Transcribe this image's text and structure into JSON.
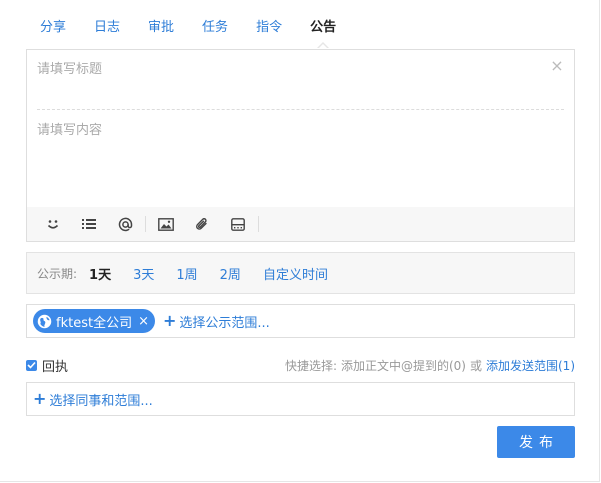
{
  "tabs": [
    {
      "label": "分享",
      "active": false
    },
    {
      "label": "日志",
      "active": false
    },
    {
      "label": "审批",
      "active": false
    },
    {
      "label": "任务",
      "active": false
    },
    {
      "label": "指令",
      "active": false
    },
    {
      "label": "公告",
      "active": true
    }
  ],
  "editor": {
    "title_placeholder": "请填写标题",
    "title_value": "",
    "content_placeholder": "请填写内容",
    "content_value": "",
    "clear_symbol": "×",
    "toolbar_icons": [
      "emoji-icon",
      "list-icon",
      "at-icon",
      "image-icon",
      "attachment-icon",
      "keyboard-icon"
    ]
  },
  "period": {
    "label": "公示期:",
    "options": [
      {
        "label": "1天",
        "active": true
      },
      {
        "label": "3天",
        "active": false
      },
      {
        "label": "1周",
        "active": false
      },
      {
        "label": "2周",
        "active": false
      },
      {
        "label": "自定义时间",
        "active": false
      }
    ]
  },
  "scope": {
    "chip_label": "fktest全公司",
    "chip_close": "×",
    "add_label": "选择公示范围..."
  },
  "receipt": {
    "label": "回执",
    "checked": true,
    "quick_label": "快捷选择:",
    "quick_mention": "添加正文中@提到的(0)",
    "quick_or": "或",
    "quick_add_scope": "添加发送范围(1)"
  },
  "colleague": {
    "add_label": "选择同事和范围..."
  },
  "publish": {
    "label": "发布"
  },
  "colors": {
    "accent": "#3c89e8",
    "link": "#2e7dd7"
  }
}
